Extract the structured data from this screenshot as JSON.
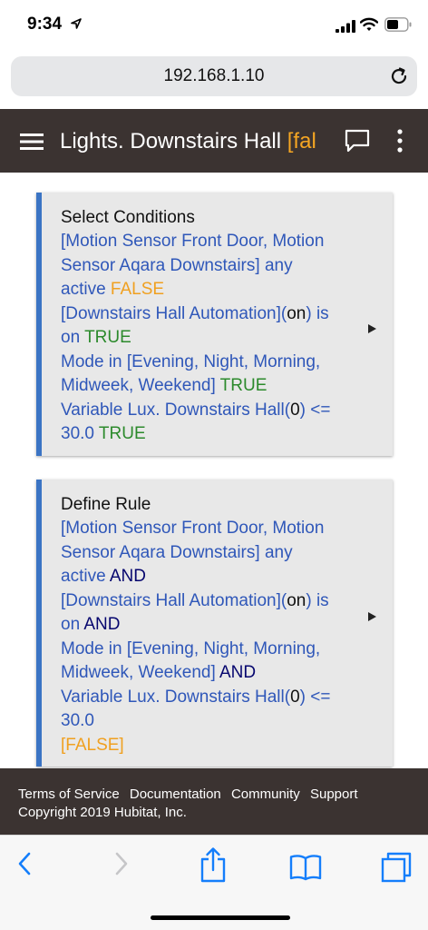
{
  "status": {
    "time": "9:34"
  },
  "browser": {
    "url": "192.168.1.10"
  },
  "header": {
    "title": "Lights. Downstairs Hall ",
    "title_state": "[fal"
  },
  "cards": [
    {
      "title": "Select Conditions",
      "lines": [
        [
          {
            "t": "[Motion Sensor Front Door, Motion",
            "c": "b"
          }
        ],
        [
          {
            "t": "Sensor Aqara Downstairs] any",
            "c": "b"
          }
        ],
        [
          {
            "t": "active ",
            "c": "b"
          },
          {
            "t": "FALSE",
            "c": "false"
          }
        ],
        [
          {
            "t": "[Downstairs Hall Automation](",
            "c": "b"
          },
          {
            "t": "on",
            "c": "blk"
          },
          {
            "t": ") is",
            "c": "b"
          }
        ],
        [
          {
            "t": "on ",
            "c": "b"
          },
          {
            "t": "TRUE",
            "c": "true"
          }
        ],
        [
          {
            "t": "Mode in [Evening, Night, Morning,",
            "c": "b"
          }
        ],
        [
          {
            "t": "Midweek, Weekend] ",
            "c": "b"
          },
          {
            "t": "TRUE",
            "c": "true"
          }
        ],
        [
          {
            "t": "Variable Lux. Downstairs Hall(",
            "c": "b"
          },
          {
            "t": "0",
            "c": "blk"
          },
          {
            "t": ") <=",
            "c": "b"
          }
        ],
        [
          {
            "t": "30.0 ",
            "c": "b"
          },
          {
            "t": "TRUE",
            "c": "true"
          }
        ]
      ]
    },
    {
      "title": "Define Rule",
      "lines": [
        [
          {
            "t": "[Motion Sensor Front Door, Motion",
            "c": "b"
          }
        ],
        [
          {
            "t": "Sensor Aqara Downstairs] any",
            "c": "b"
          }
        ],
        [
          {
            "t": "active ",
            "c": "b"
          },
          {
            "t": " AND",
            "c": "and"
          }
        ],
        [
          {
            "t": "[Downstairs Hall Automation](",
            "c": "b"
          },
          {
            "t": "on",
            "c": "blk"
          },
          {
            "t": ") is",
            "c": "b"
          }
        ],
        [
          {
            "t": "on ",
            "c": "b"
          },
          {
            "t": " AND",
            "c": "and"
          }
        ],
        [
          {
            "t": "Mode in [Evening, Night, Morning,",
            "c": "b"
          }
        ],
        [
          {
            "t": "Midweek, Weekend] ",
            "c": "b"
          },
          {
            "t": " AND",
            "c": "and"
          }
        ],
        [
          {
            "t": "Variable Lux. Downstairs Hall(",
            "c": "b"
          },
          {
            "t": "0",
            "c": "blk"
          },
          {
            "t": ") <=",
            "c": "b"
          }
        ],
        [
          {
            "t": "30.0",
            "c": "b"
          }
        ],
        [
          {
            "t": "[FALSE]",
            "c": "false"
          }
        ]
      ]
    }
  ],
  "footer": {
    "links": [
      "Terms of Service",
      "Documentation",
      "Community",
      "Support"
    ],
    "copyright": "Copyright 2019 Hubitat, Inc."
  },
  "colors": {
    "header_bg": "#3b3331",
    "card_accent": "#3b74c4",
    "text_blue": "#2f57b9",
    "true_green": "#2c8a2c",
    "false_orange": "#f0a020",
    "and_navy": "#06066e",
    "ios_blue": "#147efb"
  },
  "icons": [
    "location-arrow-icon",
    "signal-icon",
    "wifi-icon",
    "battery-icon",
    "reload-icon",
    "menu-icon",
    "comment-icon",
    "kebab-menu-icon",
    "expand-arrow-icon",
    "back-icon",
    "forward-icon",
    "share-icon",
    "bookmarks-icon",
    "tabs-icon"
  ]
}
